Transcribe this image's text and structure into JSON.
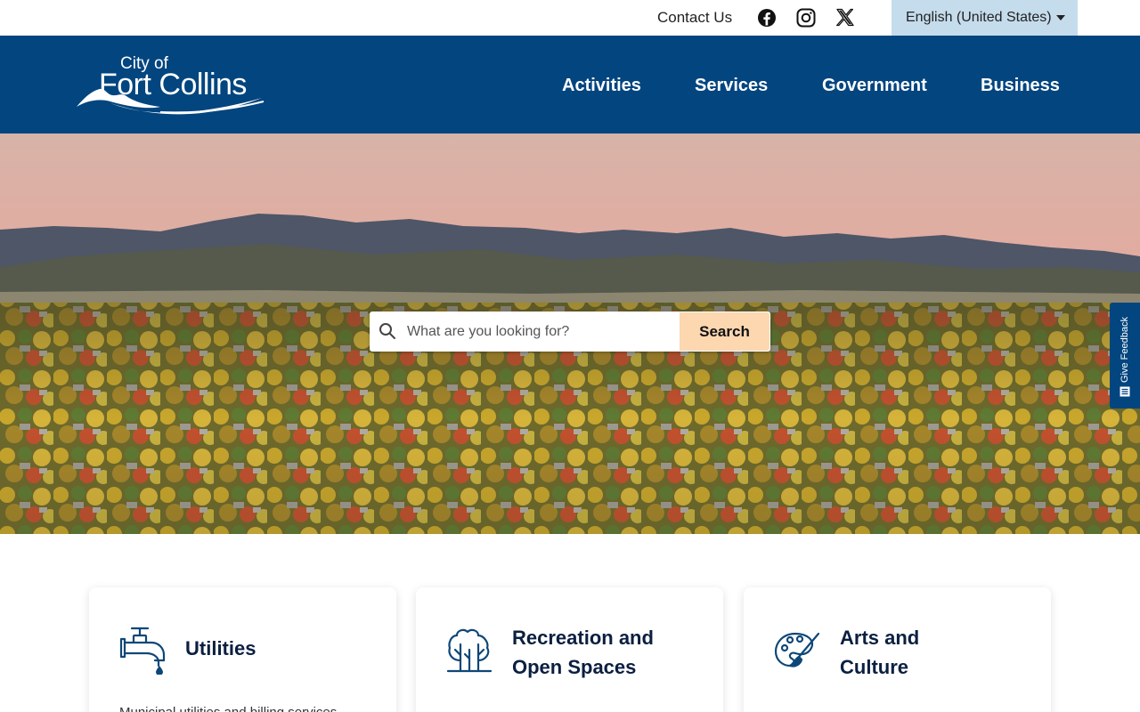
{
  "utility_bar": {
    "contact_label": "Contact Us",
    "social_icons": [
      "facebook-icon",
      "instagram-icon",
      "x-icon"
    ],
    "language": "English (United States)"
  },
  "header": {
    "logo_line1": "City of",
    "logo_line2": "Fort Collins",
    "nav": [
      "Activities",
      "Services",
      "Government",
      "Business"
    ],
    "color": "#03457f"
  },
  "hero": {
    "search_placeholder": "What are you looking for?",
    "search_button": "Search",
    "search_button_color": "#fcd7b0"
  },
  "feedback": {
    "label": "Give Feedback"
  },
  "cards": [
    {
      "icon": "faucet-icon",
      "title": "Utilities",
      "text": "Municipal utilities and billing services"
    },
    {
      "icon": "trees-icon",
      "title": "Recreation and Open Spaces"
    },
    {
      "icon": "palette-icon",
      "title": "Arts and Culture"
    }
  ],
  "colors": {
    "accent": "#03457f",
    "language_bg": "#c5dcec",
    "card_title": "#0b1f40"
  }
}
